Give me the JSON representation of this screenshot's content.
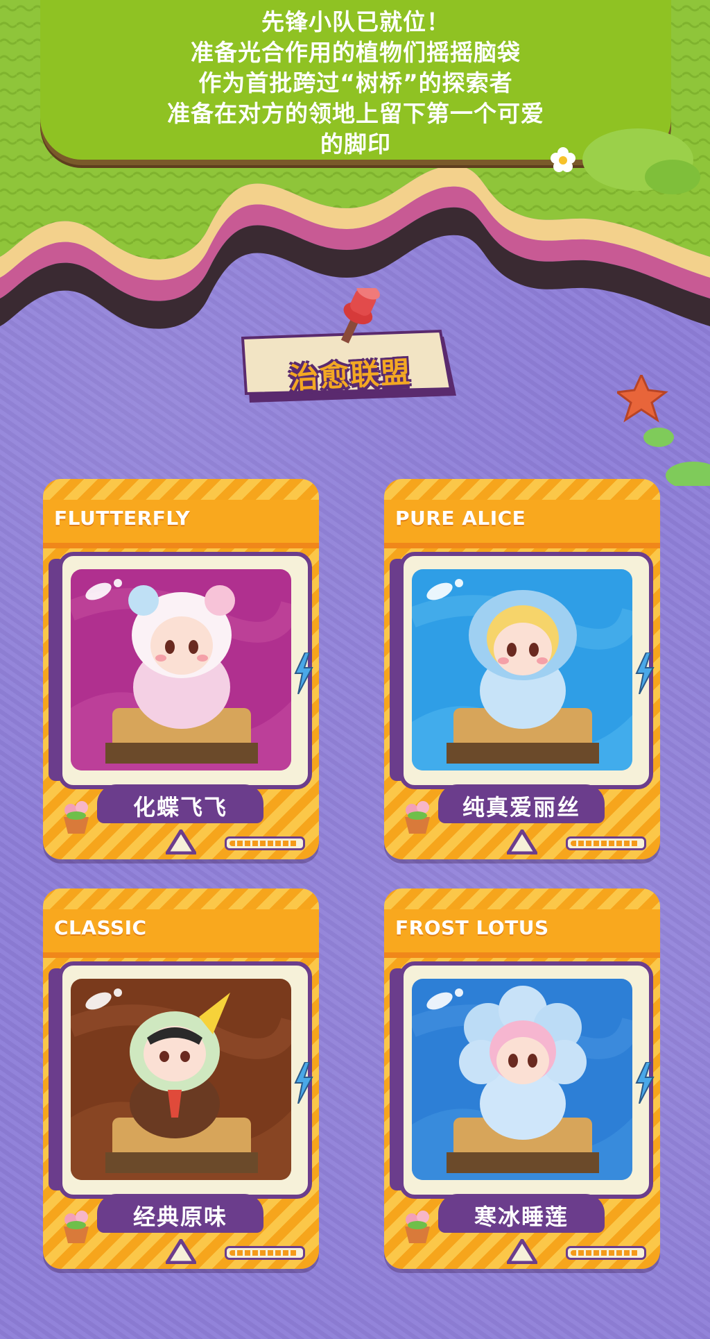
{
  "banner": {
    "lines": [
      "先锋小队已就位！",
      "准备光合作用的植物们摇摇脑袋",
      "作为首批跨过“树桥”的探索者",
      "准备在对方的领地上留下第一个可爱",
      "的脚印"
    ]
  },
  "section": {
    "title": "治愈联盟"
  },
  "cards": [
    {
      "title": "FLUTTERFLY",
      "name": "化蝶飞飞",
      "bg_color": "#b0308f",
      "figure": "white-pink hooded figure"
    },
    {
      "title": "PURE ALICE",
      "name": "纯真爱丽丝",
      "bg_color": "#2f9ee6",
      "figure": "blue hooded figure"
    },
    {
      "title": "CLASSIC",
      "name": "经典原味",
      "bg_color": "#7a3a1c",
      "figure": "green hooded figure with tie"
    },
    {
      "title": "FROST LOTUS",
      "name": "寒冰睡莲",
      "bg_color": "#2d7fd6",
      "figure": "icy lotus hooded figure"
    }
  ],
  "colors": {
    "grass": "#8fc223",
    "wave_pink": "#c85a94",
    "wave_dark": "#3a2a32",
    "wave_cream": "#f3d18c",
    "purple_bg": "#8e7ed8",
    "card_orange": "#f9a81e",
    "card_purple": "#6b3d8c"
  },
  "progress_level": 0.9
}
